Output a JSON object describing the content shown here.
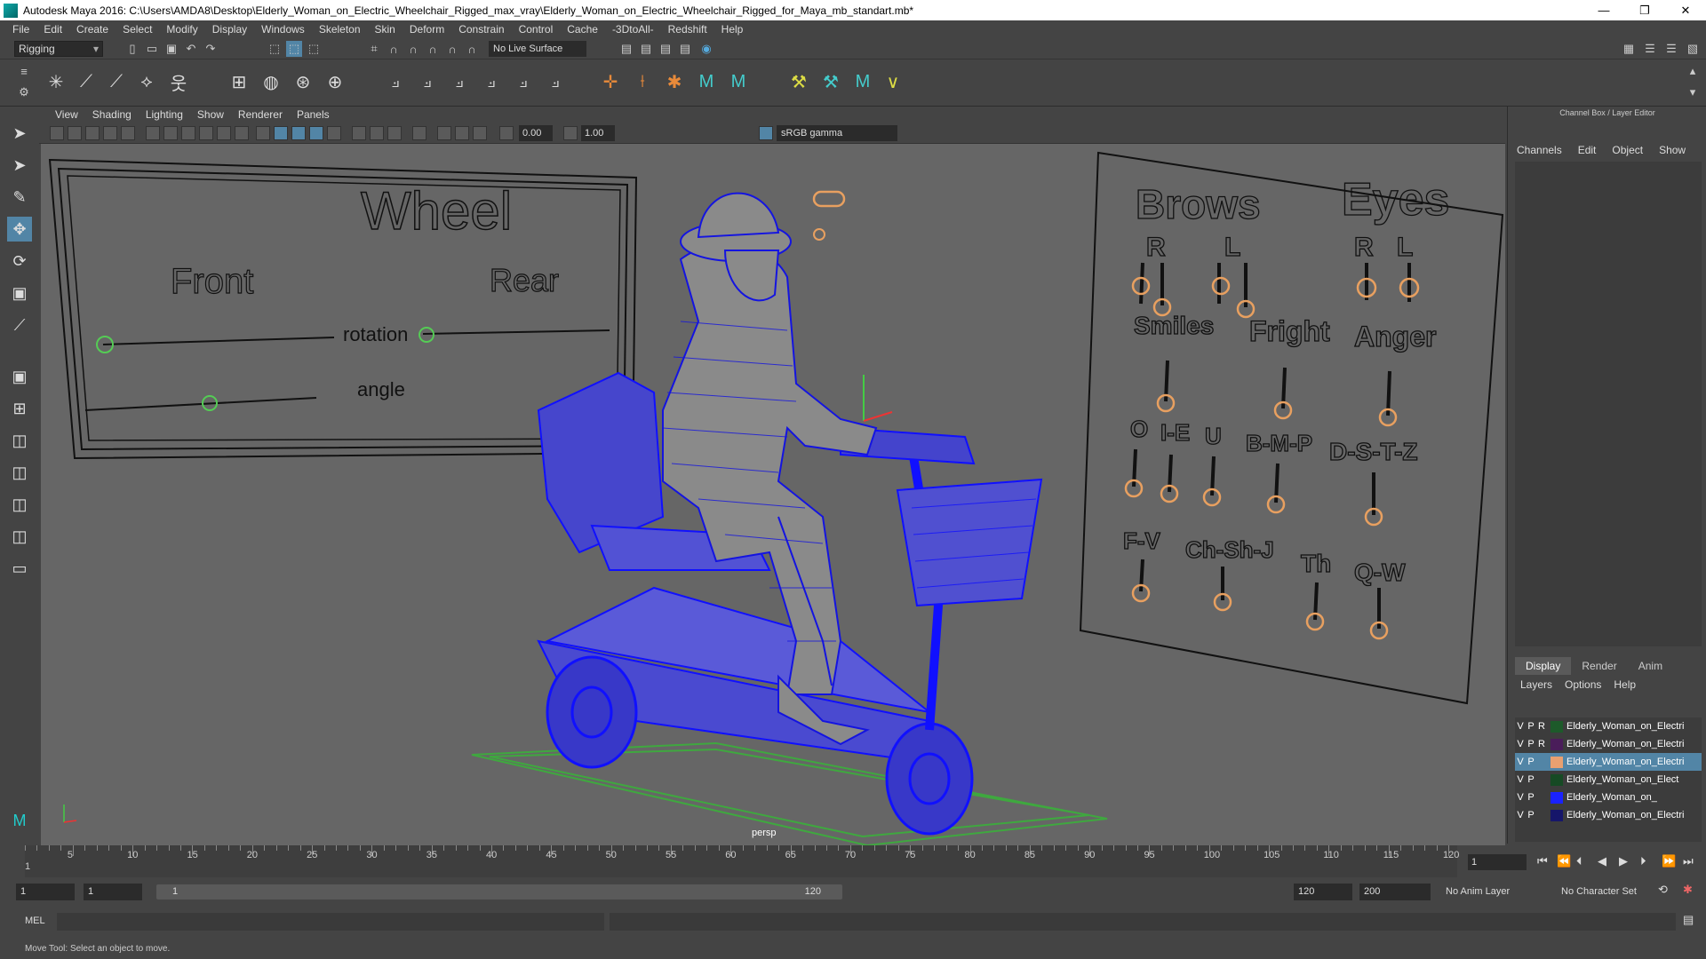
{
  "window": {
    "title": "Autodesk Maya 2016: C:\\Users\\AMDA8\\Desktop\\Elderly_Woman_on_Electric_Wheelchair_Rigged_max_vray\\Elderly_Woman_on_Electric_Wheelchair_Rigged_for_Maya_mb_standart.mb*"
  },
  "menubar": {
    "items": [
      "File",
      "Edit",
      "Create",
      "Select",
      "Modify",
      "Display",
      "Windows",
      "Skeleton",
      "Skin",
      "Deform",
      "Constrain",
      "Control",
      "Cache",
      "-3DtoAll-",
      "Redshift",
      "Help"
    ]
  },
  "statusline": {
    "mode": "Rigging",
    "live_surface": "No Live Surface"
  },
  "panel": {
    "menu": [
      "View",
      "Shading",
      "Lighting",
      "Show",
      "Renderer",
      "Panels"
    ],
    "near_value": "0.00",
    "far_value": "1.00",
    "color_space": "sRGB gamma",
    "camera_label": "persp"
  },
  "board_left": {
    "title": "Wheel",
    "front": "Front",
    "rear": "Rear",
    "rotation": "rotation",
    "angle": "angle"
  },
  "board_right": {
    "brows": "Brows",
    "eyes": "Eyes",
    "brows_r": "R",
    "brows_l": "L",
    "eyes_r": "R",
    "eyes_l": "L",
    "smiles": "Smiles",
    "fright": "Fright",
    "anger": "Anger",
    "o": "O",
    "ie": "I-E",
    "u": "U",
    "bmp": "B-M-P",
    "dstz": "D-S-T-Z",
    "fv": "F-V",
    "chshj": "Ch-Sh-J",
    "th": "Th",
    "qw": "Q-W"
  },
  "channel_box": {
    "header": "Channel Box / Layer Editor",
    "menu": [
      "Channels",
      "Edit",
      "Object",
      "Show"
    ]
  },
  "layer_editor": {
    "tabs": [
      "Display",
      "Render",
      "Anim"
    ],
    "active_tab": "Display",
    "menu": [
      "Layers",
      "Options",
      "Help"
    ],
    "layers": [
      {
        "v": "V",
        "p": "P",
        "r": "R",
        "name": "Elderly_Woman_on_Electri",
        "color": "#1d5a2a",
        "selected": false
      },
      {
        "v": "V",
        "p": "P",
        "r": "R",
        "name": "Elderly_Woman_on_Electri",
        "color": "#4a1d5a",
        "selected": false
      },
      {
        "v": "V",
        "p": "P",
        "r": "",
        "name": "Elderly_Woman_on_Electri",
        "color": "#e8a070",
        "selected": true
      },
      {
        "v": "V",
        "p": "P",
        "r": "",
        "name": "Elderly_Woman_on_Elect",
        "color": "#164a24",
        "selected": false
      },
      {
        "v": "V",
        "p": "P",
        "r": "",
        "name": "Elderly_Woman_on_",
        "color": "#1a22ff",
        "selected": false
      },
      {
        "v": "V",
        "p": "P",
        "r": "",
        "name": "Elderly_Woman_on_Electri",
        "color": "#16166a",
        "selected": false
      }
    ]
  },
  "timeline": {
    "ticks": [
      "5",
      "10",
      "15",
      "20",
      "25",
      "30",
      "35",
      "40",
      "45",
      "50",
      "55",
      "60",
      "65",
      "70",
      "75",
      "80",
      "85",
      "90",
      "95",
      "100",
      "105",
      "110",
      "115",
      "120"
    ],
    "start_label": "1",
    "current_frame": "1"
  },
  "range": {
    "start": "1",
    "anim_start": "1",
    "slider_start": "1",
    "slider_end": "120",
    "end": "120",
    "anim_end": "200",
    "anim_layer": "No Anim Layer",
    "char_set": "No Character Set"
  },
  "mel": {
    "label": "MEL"
  },
  "help": {
    "text": "Move Tool: Select an object to move."
  },
  "colors": {
    "wire": "#1010ff",
    "control": "#e8a060",
    "viewport_bg": "#666666"
  }
}
